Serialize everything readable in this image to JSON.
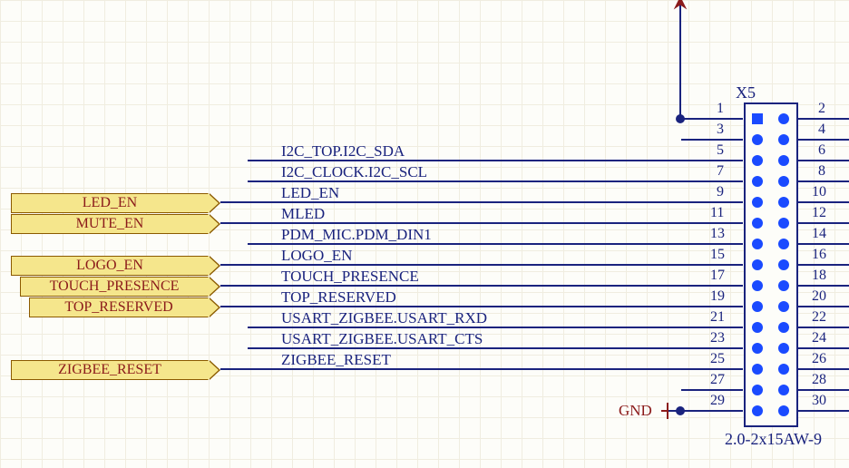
{
  "connector": {
    "designator": "X5",
    "footprint": "2.0-2x15AW-9"
  },
  "ports": {
    "led_en": "LED_EN",
    "mute_en": "MUTE_EN",
    "logo_en": "LOGO_EN",
    "touch_presence": "TOUCH_PRESENCE",
    "top_reserved": "TOP_RESERVED",
    "zigbee_reset": "ZIGBEE_RESET"
  },
  "nets": {
    "n5": "I2C_TOP.I2C_SDA",
    "n7": "I2C_CLOCK.I2C_SCL",
    "n9": "LED_EN",
    "n11": "MLED",
    "n13": "PDM_MIC.PDM_DIN1",
    "n15": "LOGO_EN",
    "n17": "TOUCH_PRESENCE",
    "n19": "TOP_RESERVED",
    "n21": "USART_ZIGBEE.USART_RXD",
    "n23": "USART_ZIGBEE.USART_CTS",
    "n25": "ZIGBEE_RESET"
  },
  "power": {
    "gnd": "GND"
  },
  "pins": {
    "p1": "1",
    "p2": "2",
    "p3": "3",
    "p4": "4",
    "p5": "5",
    "p6": "6",
    "p7": "7",
    "p8": "8",
    "p9": "9",
    "p10": "10",
    "p11": "11",
    "p12": "12",
    "p13": "13",
    "p14": "14",
    "p15": "15",
    "p16": "16",
    "p17": "17",
    "p18": "18",
    "p19": "19",
    "p20": "20",
    "p21": "21",
    "p22": "22",
    "p23": "23",
    "p24": "24",
    "p25": "25",
    "p26": "26",
    "p27": "27",
    "p28": "28",
    "p29": "29",
    "p30": "30"
  }
}
